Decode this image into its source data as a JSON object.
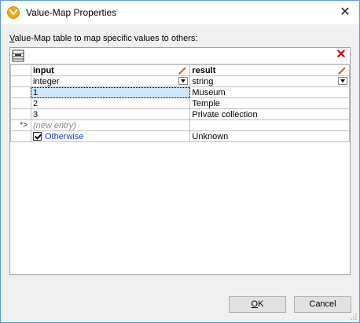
{
  "window": {
    "title": "Value-Map Properties",
    "close_glyph": "✕",
    "icon": "value-map-app-icon"
  },
  "caption": {
    "mnemonic": "V",
    "rest": "alue-Map table to map specific values to others:"
  },
  "toolbar": {
    "left_icon": "insert-row-icon",
    "right_icon": "delete-row-icon",
    "delete_glyph": "✕"
  },
  "columns": [
    {
      "header": "input",
      "type": "integer",
      "edit_icon": "pencil-icon"
    },
    {
      "header": "result",
      "type": "string",
      "edit_icon": "pencil-icon"
    }
  ],
  "rows": [
    {
      "input": "1",
      "result": "Museum",
      "selected": true
    },
    {
      "input": "2",
      "result": "Temple"
    },
    {
      "input": "3",
      "result": "Private collection"
    }
  ],
  "new_entry": {
    "marker": "*>",
    "placeholder": "(new entry)"
  },
  "otherwise": {
    "label": "Otherwise",
    "checked": true,
    "result": "Unknown"
  },
  "buttons": {
    "ok_mnemonic": "O",
    "ok_rest": "K",
    "cancel": "Cancel"
  },
  "colors": {
    "selection": "#cce8ff",
    "otherwise_link": "#1a3fbf",
    "window_border": "#5b9bd5"
  }
}
